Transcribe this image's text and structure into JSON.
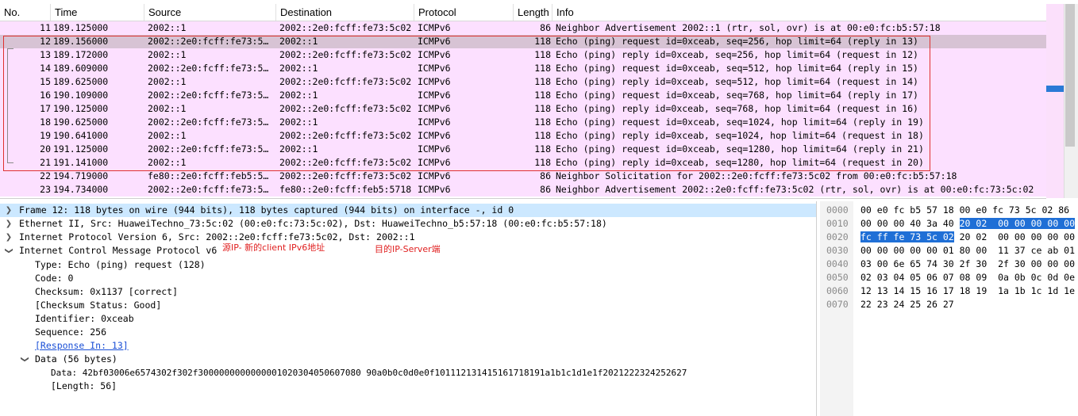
{
  "packet_list": {
    "columns": [
      "No.",
      "Time",
      "Source",
      "Destination",
      "Protocol",
      "Length",
      "Info"
    ],
    "rows": [
      {
        "no": "11",
        "time": "189.125000",
        "src": "2002::1",
        "dst": "2002::2e0:fcff:fe73:5c02",
        "proto": "ICMPv6",
        "len": "86",
        "info": "Neighbor Advertisement 2002::1 (rtr, sol, ovr) is at 00:e0:fc:b5:57:18",
        "selected": false
      },
      {
        "no": "12",
        "time": "189.156000",
        "src": "2002::2e0:fcff:fe73:5…",
        "dst": "2002::1",
        "proto": "ICMPv6",
        "len": "118",
        "info": "Echo (ping) request id=0xceab, seq=256, hop limit=64 (reply in 13)",
        "selected": true
      },
      {
        "no": "13",
        "time": "189.172000",
        "src": "2002::1",
        "dst": "2002::2e0:fcff:fe73:5c02",
        "proto": "ICMPv6",
        "len": "118",
        "info": "Echo (ping) reply id=0xceab, seq=256, hop limit=64 (request in 12)",
        "selected": false
      },
      {
        "no": "14",
        "time": "189.609000",
        "src": "2002::2e0:fcff:fe73:5…",
        "dst": "2002::1",
        "proto": "ICMPv6",
        "len": "118",
        "info": "Echo (ping) request id=0xceab, seq=512, hop limit=64 (reply in 15)",
        "selected": false
      },
      {
        "no": "15",
        "time": "189.625000",
        "src": "2002::1",
        "dst": "2002::2e0:fcff:fe73:5c02",
        "proto": "ICMPv6",
        "len": "118",
        "info": "Echo (ping) reply id=0xceab, seq=512, hop limit=64 (request in 14)",
        "selected": false
      },
      {
        "no": "16",
        "time": "190.109000",
        "src": "2002::2e0:fcff:fe73:5…",
        "dst": "2002::1",
        "proto": "ICMPv6",
        "len": "118",
        "info": "Echo (ping) request id=0xceab, seq=768, hop limit=64 (reply in 17)",
        "selected": false
      },
      {
        "no": "17",
        "time": "190.125000",
        "src": "2002::1",
        "dst": "2002::2e0:fcff:fe73:5c02",
        "proto": "ICMPv6",
        "len": "118",
        "info": "Echo (ping) reply id=0xceab, seq=768, hop limit=64 (request in 16)",
        "selected": false
      },
      {
        "no": "18",
        "time": "190.625000",
        "src": "2002::2e0:fcff:fe73:5…",
        "dst": "2002::1",
        "proto": "ICMPv6",
        "len": "118",
        "info": "Echo (ping) request id=0xceab, seq=1024, hop limit=64 (reply in 19)",
        "selected": false
      },
      {
        "no": "19",
        "time": "190.641000",
        "src": "2002::1",
        "dst": "2002::2e0:fcff:fe73:5c02",
        "proto": "ICMPv6",
        "len": "118",
        "info": "Echo (ping) reply id=0xceab, seq=1024, hop limit=64 (request in 18)",
        "selected": false
      },
      {
        "no": "20",
        "time": "191.125000",
        "src": "2002::2e0:fcff:fe73:5…",
        "dst": "2002::1",
        "proto": "ICMPv6",
        "len": "118",
        "info": "Echo (ping) request id=0xceab, seq=1280, hop limit=64 (reply in 21)",
        "selected": false
      },
      {
        "no": "21",
        "time": "191.141000",
        "src": "2002::1",
        "dst": "2002::2e0:fcff:fe73:5c02",
        "proto": "ICMPv6",
        "len": "118",
        "info": "Echo (ping) reply id=0xceab, seq=1280, hop limit=64 (request in 20)",
        "selected": false
      },
      {
        "no": "22",
        "time": "194.719000",
        "src": "fe80::2e0:fcff:feb5:5…",
        "dst": "2002::2e0:fcff:fe73:5c02",
        "proto": "ICMPv6",
        "len": "86",
        "info": "Neighbor Solicitation for 2002::2e0:fcff:fe73:5c02 from 00:e0:fc:b5:57:18",
        "selected": false
      },
      {
        "no": "23",
        "time": "194.734000",
        "src": "2002::2e0:fcff:fe73:5…",
        "dst": "fe80::2e0:fcff:feb5:5718",
        "proto": "ICMPv6",
        "len": "86",
        "info": "Neighbor Advertisement 2002::2e0:fcff:fe73:5c02 (rtr, sol, ovr) is at 00:e0:fc:73:5c:02",
        "selected": false
      }
    ],
    "row_bg": "#fce0ff",
    "selected_bg": "#d7c3d4",
    "highlight_color": "#e03030"
  },
  "details": {
    "frame": "Frame 12: 118 bytes on wire (944 bits), 118 bytes captured (944 bits) on interface -, id 0",
    "ethernet": "Ethernet II, Src: HuaweiTechno_73:5c:02 (00:e0:fc:73:5c:02), Dst: HuaweiTechno_b5:57:18 (00:e0:fc:b5:57:18)",
    "ipv6": "Internet Protocol Version 6, Src: 2002::2e0:fcff:fe73:5c02, Dst: 2002::1",
    "icmpv6": "Internet Control Message Protocol v6",
    "type": "Type: Echo (ping) request (128)",
    "code": "Code: 0",
    "checksum": "Checksum: 0x1137 [correct]",
    "checksum_status": "[Checksum Status: Good]",
    "identifier": "Identifier: 0xceab",
    "sequence": "Sequence: 256",
    "response_in": "[Response In: 13]",
    "data_header": "Data (56 bytes)",
    "data_value": "Data: 42bf03006e6574302f302f3000000000000001020304050607080 90a0b0c0d0e0f101112131415161718191a1b1c1d1e1f2021222324252627",
    "data_length": "[Length: 56]",
    "annotation_src": "源IP- 新的client IPv6地址",
    "annotation_dst": "目的IP-Server端"
  },
  "bytes": {
    "lines": [
      {
        "offset": "0000",
        "pre": "00 e0 fc b5 57 18 00 e0  fc 73 5c 02 86",
        "hl": "",
        "post": ""
      },
      {
        "offset": "0010",
        "pre": "00 00 00 40 3a 40 ",
        "hl": "20 02  00 00 00 00 00",
        "post": ""
      },
      {
        "offset": "0020",
        "pre": "",
        "hl": "fc ff fe 73 5c 02",
        "post": " 20 02  00 00 00 00 00"
      },
      {
        "offset": "0030",
        "pre": "00 00 00 00 00 01 80 00  11 37 ce ab 01",
        "hl": "",
        "post": ""
      },
      {
        "offset": "0040",
        "pre": "03 00 6e 65 74 30 2f 30  2f 30 00 00 00",
        "hl": "",
        "post": ""
      },
      {
        "offset": "0050",
        "pre": "02 03 04 05 06 07 08 09  0a 0b 0c 0d 0e",
        "hl": "",
        "post": ""
      },
      {
        "offset": "0060",
        "pre": "12 13 14 15 16 17 18 19  1a 1b 1c 1d 1e",
        "hl": "",
        "post": ""
      },
      {
        "offset": "0070",
        "pre": "22 23 24 25 26 27",
        "hl": "",
        "post": ""
      }
    ],
    "highlight_color": "#1f6fd6"
  }
}
